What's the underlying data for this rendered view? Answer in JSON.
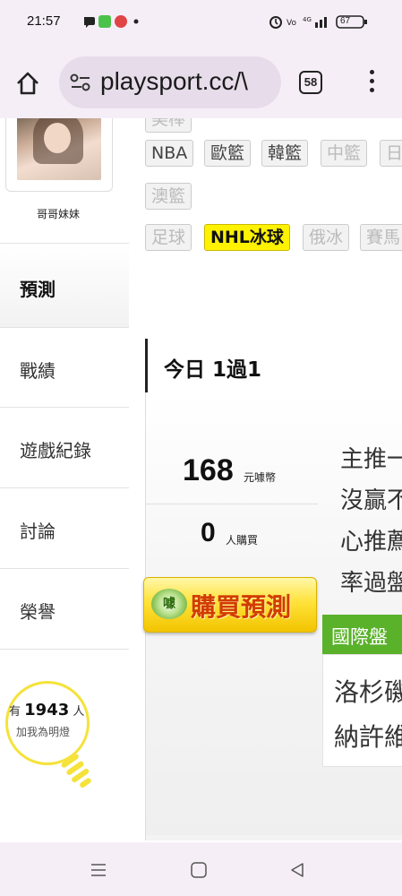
{
  "status_bar": {
    "time": "21:57",
    "battery": "67"
  },
  "browser": {
    "url": "playsport.cc/\\",
    "tab_count": "58"
  },
  "sidebar": {
    "username": "哥哥妹妹",
    "nav_items": [
      {
        "label": "預測",
        "active": true
      },
      {
        "label": "戰績"
      },
      {
        "label": "遊戲紀錄"
      },
      {
        "label": "討論"
      },
      {
        "label": "榮譽"
      }
    ],
    "follow": {
      "prefix": "有",
      "count": "1943",
      "suffix": "人",
      "cta": "加我為明燈"
    }
  },
  "categories": {
    "row0_partial": "美棒",
    "row1": [
      "NBA",
      "歐籃",
      "韓籃",
      "中籃",
      "日"
    ],
    "row2": [
      "澳籃"
    ],
    "row3": [
      "足球",
      "NHL冰球",
      "俄冰",
      "賽馬"
    ],
    "active": "NHL冰球"
  },
  "content": {
    "date_title": "今日 1過1",
    "price": {
      "value": "168",
      "unit": "元噱幣"
    },
    "buyers": {
      "value": "0",
      "unit": "人購買"
    },
    "buy_button": {
      "badge": "噱",
      "label": "購買預測"
    },
    "description_lines": [
      "主推一",
      "沒贏不",
      "心推薦",
      "率過盤"
    ],
    "pick": {
      "market": "國際盤",
      "team_lines": [
        "洛杉磯",
        "納許維"
      ]
    }
  }
}
